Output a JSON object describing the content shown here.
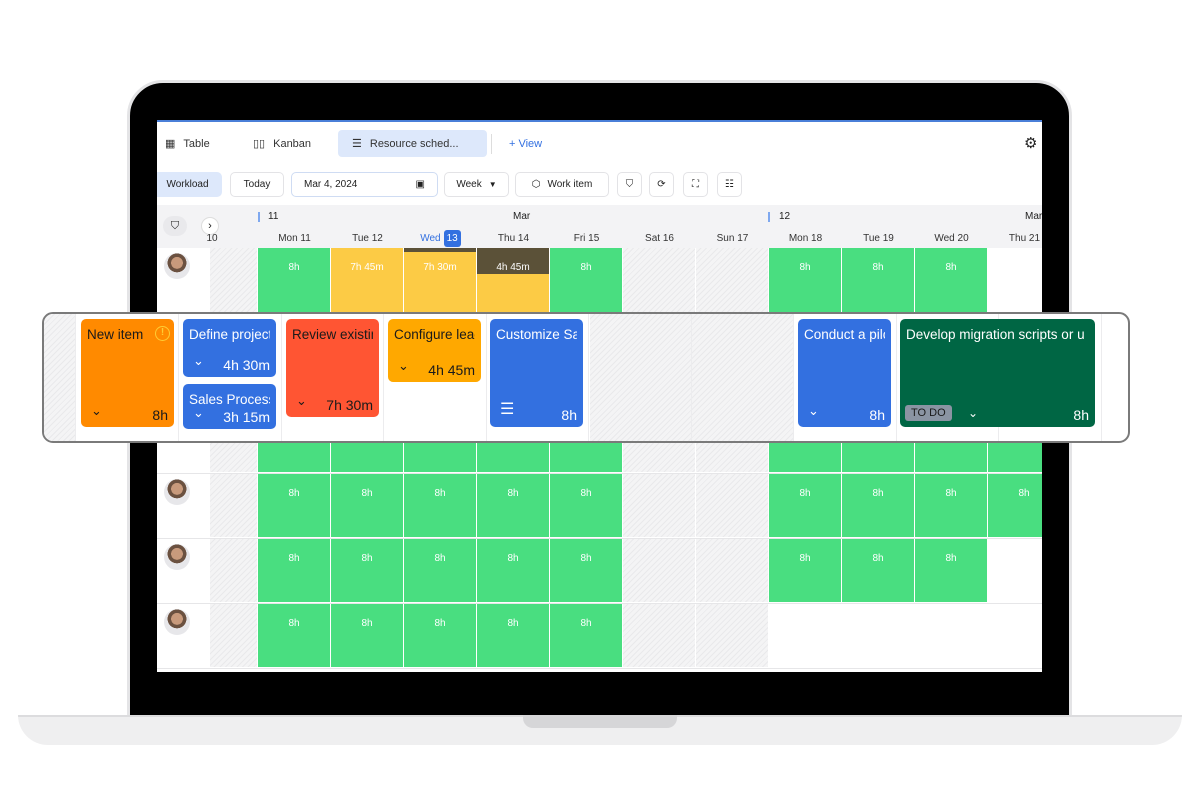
{
  "tabs": [
    {
      "label": "Table",
      "icon": "table-icon"
    },
    {
      "label": "Kanban",
      "icon": "kanban-icon"
    },
    {
      "label": "Resource sched...",
      "icon": "schedule-icon",
      "active": true
    }
  ],
  "add_view": "+ View",
  "toolbar": {
    "workload": "Workload",
    "today": "Today",
    "date": "Mar 4, 2024",
    "week": "Week",
    "work_item": "Work item"
  },
  "timeline": {
    "weeks": [
      "11",
      "Mar",
      "12",
      "Mar"
    ],
    "prev_day": "10",
    "days": [
      "Mon 11",
      "Tue 12",
      "Wed",
      "Thu 14",
      "Fri 15",
      "Sat 16",
      "Sun 17",
      "Mon 18",
      "Tue 19",
      "Wed 20",
      "Thu 21"
    ],
    "today_badge": "13"
  },
  "colors": {
    "full": "#49de80",
    "partial": "#fccb45",
    "over": "#5b5138",
    "accent": "#3370e0"
  },
  "rows": [
    {
      "cells": [
        {
          "d": 0,
          "t": "8h",
          "c": "full"
        },
        {
          "d": 1,
          "t": "7h 45m",
          "c": "partial"
        },
        {
          "d": 2,
          "t": "7h 30m",
          "c": "partial",
          "band": 4
        },
        {
          "d": 3,
          "t": "4h 45m",
          "c": "partial",
          "band": 26
        },
        {
          "d": 4,
          "t": "8h",
          "c": "full"
        },
        {
          "d": 7,
          "t": "8h",
          "c": "full"
        },
        {
          "d": 8,
          "t": "8h",
          "c": "full"
        },
        {
          "d": 9,
          "t": "8h",
          "c": "full"
        }
      ]
    },
    {
      "cells": [
        {
          "d": 0,
          "t": "",
          "c": "full"
        },
        {
          "d": 1,
          "t": "",
          "c": "full"
        },
        {
          "d": 2,
          "t": "",
          "c": "full"
        },
        {
          "d": 3,
          "t": "",
          "c": "full"
        },
        {
          "d": 4,
          "t": "",
          "c": "full"
        },
        {
          "d": 7,
          "t": "",
          "c": "full"
        },
        {
          "d": 8,
          "t": "",
          "c": "full"
        },
        {
          "d": 9,
          "t": "",
          "c": "full"
        },
        {
          "d": 10,
          "t": "",
          "c": "full"
        }
      ]
    },
    {
      "cells": [
        {
          "d": 0,
          "t": "8h",
          "c": "full"
        },
        {
          "d": 1,
          "t": "8h",
          "c": "full"
        },
        {
          "d": 2,
          "t": "8h",
          "c": "full"
        },
        {
          "d": 3,
          "t": "8h",
          "c": "full"
        },
        {
          "d": 4,
          "t": "8h",
          "c": "full"
        },
        {
          "d": 7,
          "t": "8h",
          "c": "full"
        },
        {
          "d": 8,
          "t": "8h",
          "c": "full"
        },
        {
          "d": 9,
          "t": "8h",
          "c": "full"
        },
        {
          "d": 10,
          "t": "8h",
          "c": "full"
        }
      ]
    },
    {
      "cells": [
        {
          "d": 0,
          "t": "8h",
          "c": "full"
        },
        {
          "d": 1,
          "t": "8h",
          "c": "full"
        },
        {
          "d": 2,
          "t": "8h",
          "c": "full"
        },
        {
          "d": 3,
          "t": "8h",
          "c": "full"
        },
        {
          "d": 4,
          "t": "8h",
          "c": "full"
        },
        {
          "d": 7,
          "t": "8h",
          "c": "full"
        },
        {
          "d": 8,
          "t": "8h",
          "c": "full"
        },
        {
          "d": 9,
          "t": "8h",
          "c": "full"
        }
      ]
    },
    {
      "cells": [
        {
          "d": 0,
          "t": "8h",
          "c": "full"
        },
        {
          "d": 1,
          "t": "8h",
          "c": "full"
        },
        {
          "d": 2,
          "t": "8h",
          "c": "full"
        },
        {
          "d": 3,
          "t": "8h",
          "c": "full"
        },
        {
          "d": 4,
          "t": "8h",
          "c": "full"
        }
      ]
    }
  ],
  "cards": [
    {
      "title": "New item",
      "hours": "8h",
      "color": "#ff8a00",
      "dark": true,
      "warning": true
    },
    {
      "title": "Define project",
      "hours": "4h 30m",
      "color": "#3370e0"
    },
    {
      "title": "Sales Process",
      "hours": "3h 15m",
      "color": "#3370e0"
    },
    {
      "title": "Review existing",
      "hours": "7h 30m",
      "color": "#ff5533",
      "dark": true
    },
    {
      "title": "Configure lead",
      "hours": "4h 45m",
      "color": "#ffa800",
      "dark": true
    },
    {
      "title": "Customize Sales",
      "hours": "8h",
      "color": "#3370e0",
      "icon": "list-icon"
    },
    {
      "title": "Conduct a pilot",
      "hours": "8h",
      "color": "#3370e0"
    },
    {
      "title": "Develop migration scripts or u",
      "hours": "8h",
      "color": "#006644",
      "status": "TO DO"
    }
  ]
}
